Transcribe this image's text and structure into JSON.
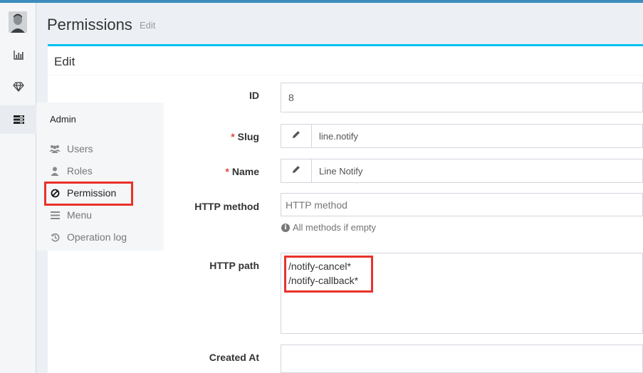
{
  "header": {
    "title": "Permissions",
    "subtitle": "Edit"
  },
  "box": {
    "title": "Edit"
  },
  "form": {
    "id": {
      "label": "ID",
      "value": "8"
    },
    "slug": {
      "label": "Slug",
      "required": "*",
      "value": "line.notify"
    },
    "name": {
      "label": "Name",
      "required": "*",
      "value": "Line Notify"
    },
    "http_method": {
      "label": "HTTP method",
      "placeholder": "HTTP method",
      "help": "All methods if empty"
    },
    "http_path": {
      "label": "HTTP path",
      "lines": [
        "/notify-cancel*",
        "/notify-callback*"
      ]
    },
    "created_at": {
      "label": "Created At",
      "value": ""
    }
  },
  "sidebar": {
    "icons": [
      "avatar",
      "bar-chart-icon",
      "diamond-icon",
      "tasks-icon"
    ]
  },
  "admin_menu": {
    "title": "Admin",
    "items": [
      {
        "label": "Users",
        "icon": "users-icon"
      },
      {
        "label": "Roles",
        "icon": "user-icon"
      },
      {
        "label": "Permission",
        "icon": "ban-icon",
        "active": true
      },
      {
        "label": "Menu",
        "icon": "bars-icon"
      },
      {
        "label": "Operation log",
        "icon": "history-icon"
      }
    ]
  },
  "colors": {
    "accent": "#3c8dbc",
    "box_border": "#00c0ef",
    "highlight": "#e8322b",
    "required": "#dd4b39"
  }
}
